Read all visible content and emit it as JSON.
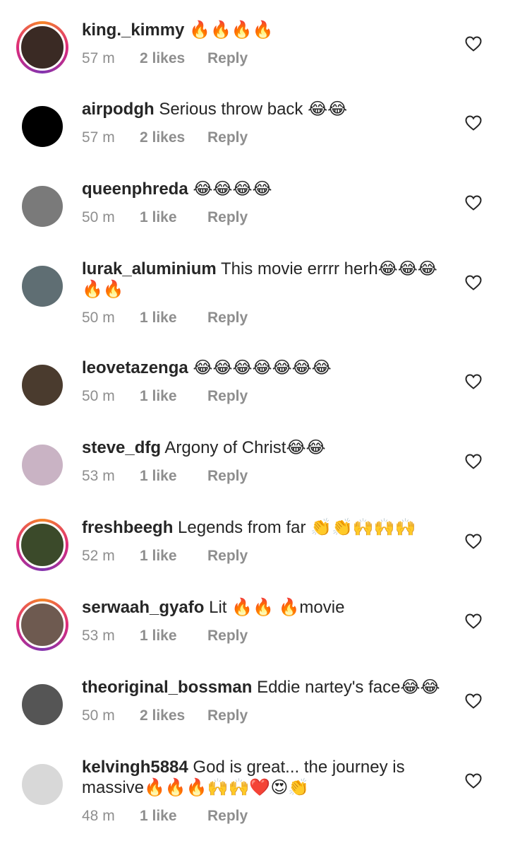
{
  "comments": [
    {
      "username": "king._kimmy",
      "text": "🔥🔥🔥🔥",
      "time": "57 m",
      "likes": "2 likes",
      "reply": "Reply",
      "avatar_color": "#3a2a24",
      "ring": true
    },
    {
      "username": "airpodgh",
      "text": "Serious throw back 😂😂",
      "time": "57 m",
      "likes": "2 likes",
      "reply": "Reply",
      "avatar_color": "#000000",
      "ring": false
    },
    {
      "username": "queenphreda",
      "text": "😂😂😂😂",
      "time": "50 m",
      "likes": "1 like",
      "reply": "Reply",
      "avatar_color": "#7a7a7a",
      "ring": false
    },
    {
      "username": "lurak_aluminium",
      "text": "This movie errrr herh😂😂😂🔥🔥",
      "time": "50 m",
      "likes": "1 like",
      "reply": "Reply",
      "avatar_color": "#5f6e73",
      "ring": false
    },
    {
      "username": "leovetazenga",
      "text": "😂😂😂😂😂😂😂",
      "time": "50 m",
      "likes": "1 like",
      "reply": "Reply",
      "avatar_color": "#4a3b2e",
      "ring": false
    },
    {
      "username": "steve_dfg",
      "text": "Argony of Christ😂😂",
      "time": "53 m",
      "likes": "1 like",
      "reply": "Reply",
      "avatar_color": "#c9b3c4",
      "ring": false
    },
    {
      "username": "freshbeegh",
      "text": "Legends from far 👏👏🙌🙌🙌",
      "time": "52 m",
      "likes": "1 like",
      "reply": "Reply",
      "avatar_color": "#3b4a2a",
      "ring": true
    },
    {
      "username": "serwaah_gyafo",
      "text": "Lit 🔥🔥 🔥movie",
      "time": "53 m",
      "likes": "1 like",
      "reply": "Reply",
      "avatar_color": "#6e5a50",
      "ring": true
    },
    {
      "username": "theoriginal_bossman",
      "text": "Eddie nartey's face😂😂",
      "time": "50 m",
      "likes": "2 likes",
      "reply": "Reply",
      "avatar_color": "#555555",
      "ring": false
    },
    {
      "username": "kelvingh5884",
      "text": "God is great... the journey is massive🔥🔥🔥🙌🙌❤️😍👏",
      "time": "48 m",
      "likes": "1 like",
      "reply": "Reply",
      "avatar_color": "#d8d8d8",
      "ring": false
    }
  ]
}
